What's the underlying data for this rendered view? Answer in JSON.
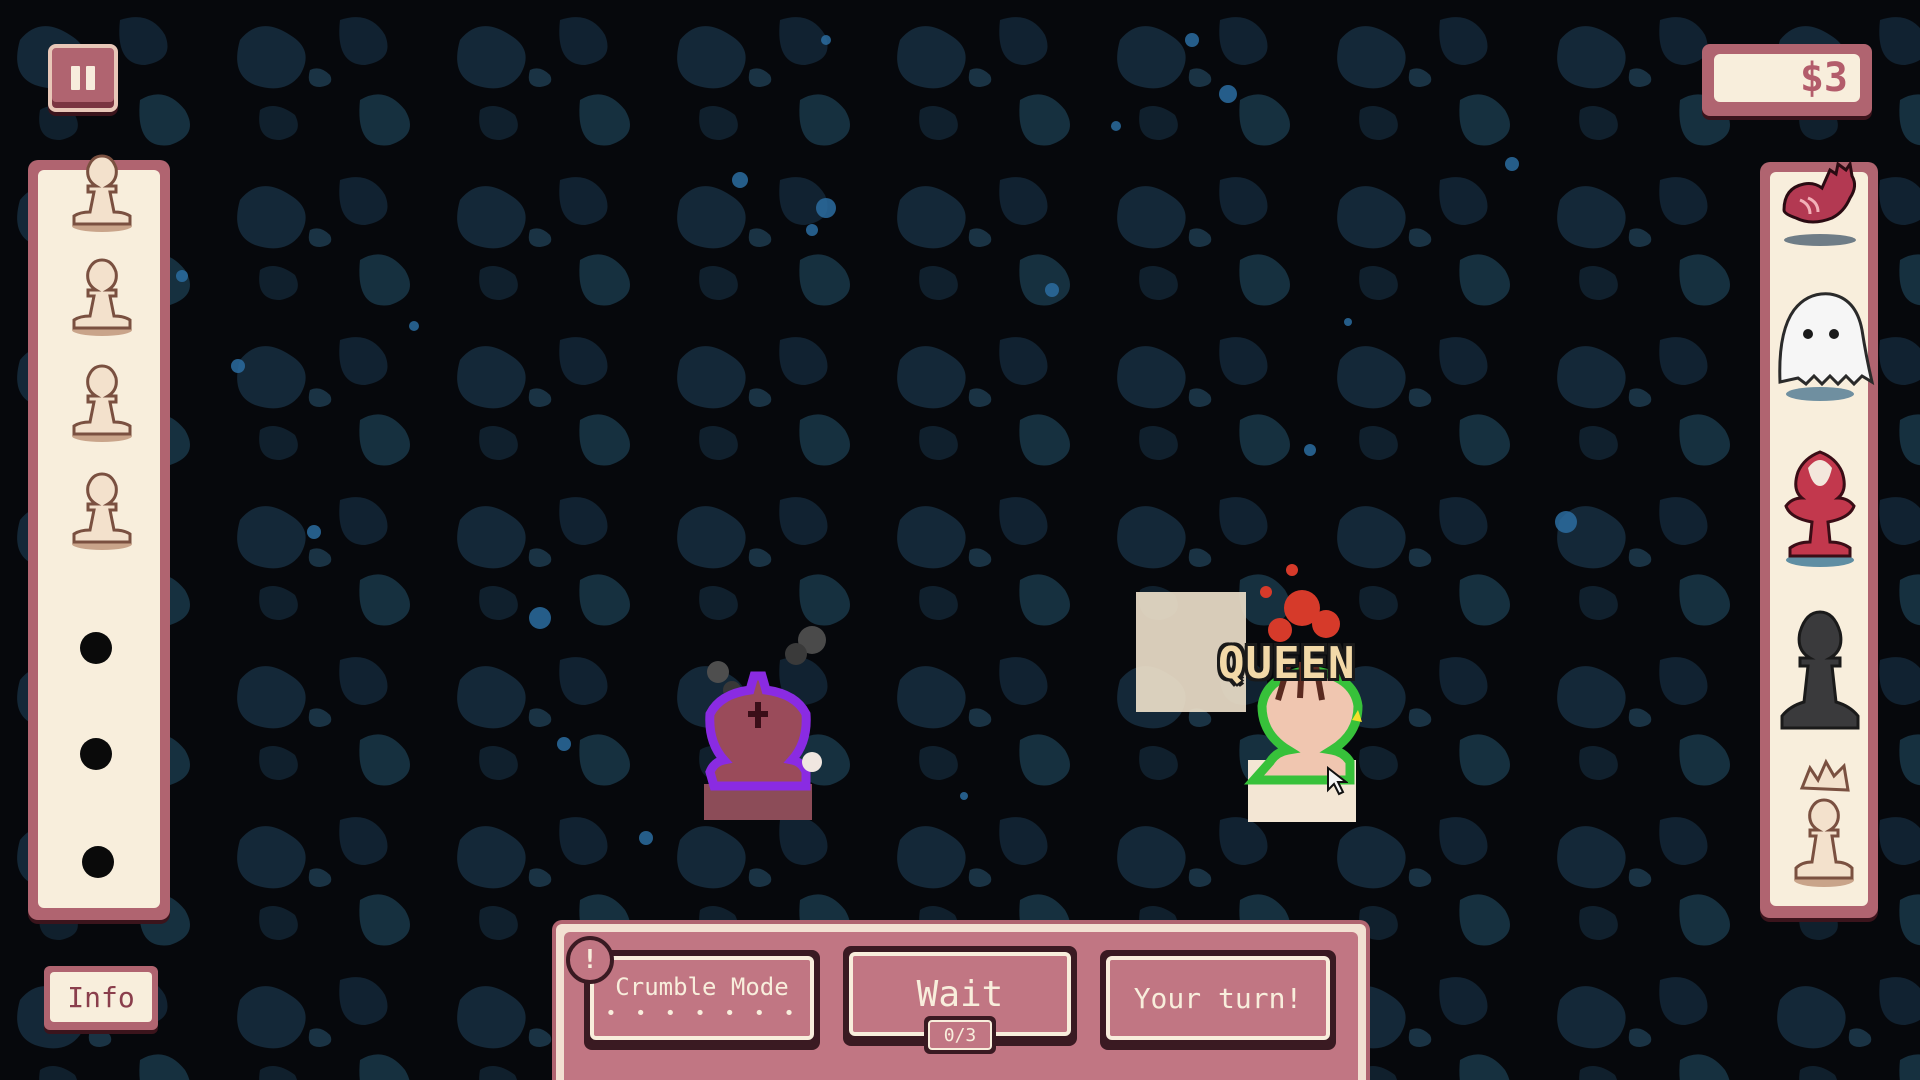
{
  "hud": {
    "money": "$3",
    "info_label": "Info"
  },
  "reserve": {
    "pawns": 4,
    "empty_slots": 3
  },
  "shop": {
    "items": [
      "rooster-icon",
      "ghost-icon",
      "bishop-icon",
      "shadow-pawn-icon",
      "crowned-pawn-icon"
    ]
  },
  "board": {
    "highlight_label": "QUEEN"
  },
  "actions": {
    "alert_symbol": "!",
    "crumble_label": "Crumble Mode",
    "crumble_dots": "• • • • • • •",
    "wait_label": "Wait",
    "wait_counter": "0/3",
    "your_turn_label": "Your turn!"
  },
  "colors": {
    "panel_border": "#b06470",
    "panel_fill": "#f8eedc",
    "button_face": "#c17683",
    "queen_outline": "#3fd13a",
    "king_outline": "#8a2be2"
  }
}
